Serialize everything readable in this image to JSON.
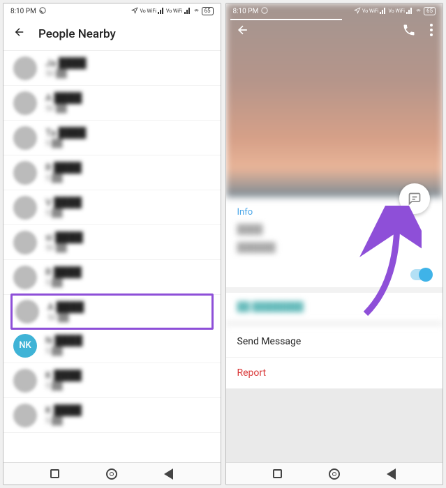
{
  "status": {
    "time": "8:10 PM",
    "battery": "65",
    "volte": "Vo WiFi"
  },
  "screen1": {
    "title": "People Nearby",
    "people": [
      {
        "name": "Ja",
        "sub": "50"
      },
      {
        "name": "A",
        "sub": "50"
      },
      {
        "name": "Ta",
        "sub": "5"
      },
      {
        "name": "R",
        "sub": "5"
      },
      {
        "name": "V",
        "sub": "5"
      },
      {
        "name": "si",
        "sub": "50"
      },
      {
        "name": "R",
        "sub": "5"
      },
      {
        "name": "A",
        "sub": "50",
        "hl": true
      },
      {
        "name": "N",
        "sub": "5",
        "nk": "NK"
      },
      {
        "name": "K",
        "sub": "5"
      },
      {
        "name": "K",
        "sub": "5"
      }
    ]
  },
  "screen2": {
    "info_label": "Info",
    "send_message": "Send Message",
    "report": "Report"
  },
  "avatar_initials": "NK"
}
